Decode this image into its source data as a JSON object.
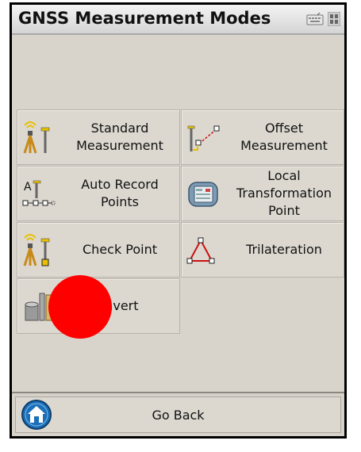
{
  "window": {
    "title": "GNSS Measurement Modes",
    "keyboard_icon": "keyboard-icon",
    "windows_icon": "windows-logo-icon"
  },
  "modes": [
    {
      "label": "Standard\nMeasurement",
      "icon": "tripod-rover-icon"
    },
    {
      "label": "Offset\nMeasurement",
      "icon": "offset-icon"
    },
    {
      "label": "Auto Record\nPoints",
      "icon": "auto-record-icon"
    },
    {
      "label": "Local\nTransformation\nPoint",
      "icon": "transformation-icon"
    },
    {
      "label": "Check Point",
      "icon": "check-point-icon"
    },
    {
      "label": "Trilateration",
      "icon": "trilateration-icon"
    },
    {
      "label": "Invert",
      "icon": "invert-icon"
    }
  ],
  "footer": {
    "back_label": "Go Back",
    "home_icon": "home-icon"
  },
  "colors": {
    "background": "#d8d4cc",
    "tile": "#dcd8d0",
    "overlay_dot": "#ff0000",
    "accent_yellow": "#e8c000",
    "accent_red": "#cc1010",
    "home_blue": "#1a6fb8"
  }
}
